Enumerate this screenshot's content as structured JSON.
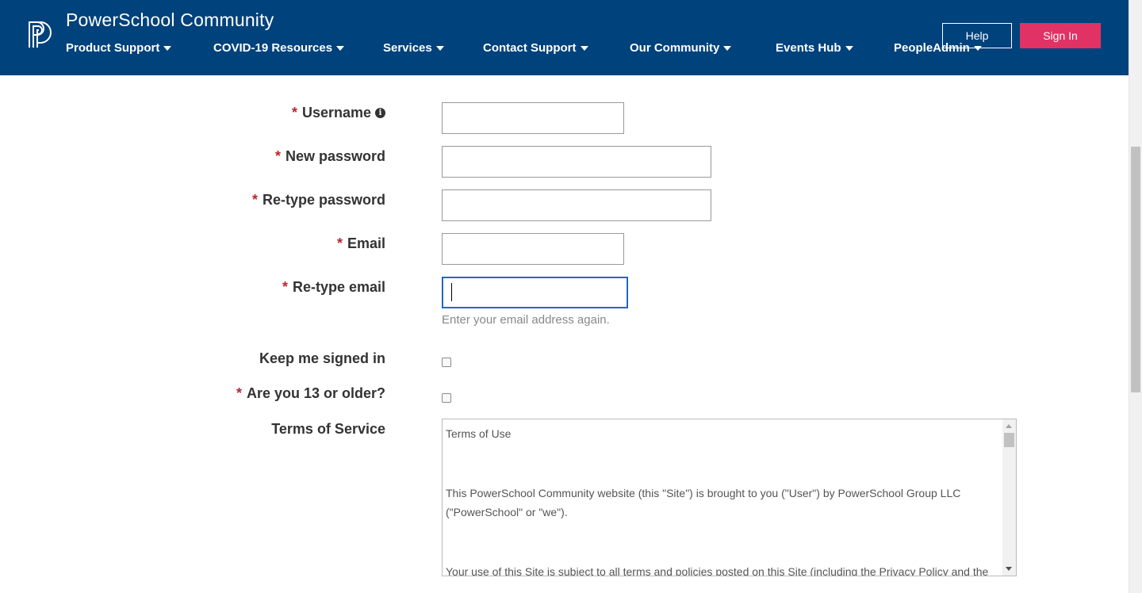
{
  "header": {
    "brand": "PowerSchool Community",
    "nav": [
      {
        "label": "Product Support"
      },
      {
        "label": "COVID-19 Resources"
      },
      {
        "label": "Services"
      },
      {
        "label": "Contact Support"
      },
      {
        "label": "Our Community"
      },
      {
        "label": "Events Hub"
      },
      {
        "label": "PeopleAdmin"
      }
    ],
    "help_label": "Help",
    "signin_label": "Sign In"
  },
  "form": {
    "required_mark": "*",
    "username_label": "Username",
    "new_password_label": "New password",
    "retype_password_label": "Re-type password",
    "email_label": "Email",
    "retype_email_label": "Re-type email",
    "retype_email_help": "Enter your email address again.",
    "keep_signed_in_label": "Keep me signed in",
    "age_label": "Are you 13 or older?",
    "terms_label": "Terms of Service",
    "username_value": "",
    "new_password_value": "",
    "retype_password_value": "",
    "email_value": "",
    "retype_email_value": "",
    "keep_signed_in_checked": false,
    "age_checked": false
  },
  "terms": {
    "heading": "Terms of Use",
    "para1": "This PowerSchool Community website (this \"Site\") is brought to you (\"User\") by PowerSchool Group LLC (\"PowerSchool\" or \"we\").",
    "para2": "Your use of this Site is subject to all terms and policies posted on this Site (including the Privacy Policy and the"
  },
  "colors": {
    "header_bg": "#00427c",
    "signin_bg": "#e03264",
    "required": "#b5292f",
    "focus": "#1a5fb4"
  },
  "icons": {
    "logo": "powerschool-logo",
    "caret": "caret-down-icon",
    "info": "info-circle-icon"
  }
}
